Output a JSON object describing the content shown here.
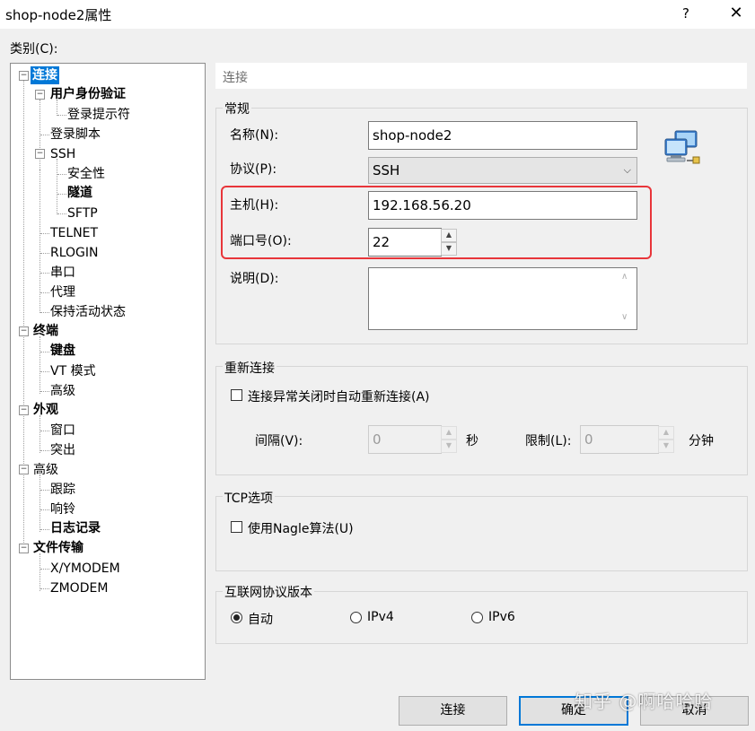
{
  "window": {
    "title": "shop-node2属性",
    "help": "?",
    "close": "✕"
  },
  "category_label": "类别(C):",
  "tree": {
    "connect": "连接",
    "auth": "用户身份验证",
    "login_prompt": "登录提示符",
    "login_script": "登录脚本",
    "ssh": "SSH",
    "security": "安全性",
    "tunnel": "隧道",
    "sftp": "SFTP",
    "telnet": "TELNET",
    "rlogin": "RLOGIN",
    "serial": "串口",
    "proxy": "代理",
    "keepalive": "保持活动状态",
    "terminal": "终端",
    "keyboard": "键盘",
    "vt_mode": "VT 模式",
    "term_advanced": "高级",
    "appearance": "外观",
    "window": "窗口",
    "highlight": "突出",
    "advanced": "高级",
    "trace": "跟踪",
    "bell": "响铃",
    "logging": "日志记录",
    "file_transfer": "文件传输",
    "xymodem": "X/YMODEM",
    "zmodem": "ZMODEM"
  },
  "section_title": "连接",
  "general": {
    "legend": "常规",
    "name_label": "名称(N):",
    "name_value": "shop-node2",
    "protocol_label": "协议(P):",
    "protocol_value": "SSH",
    "host_label": "主机(H):",
    "host_value": "192.168.56.20",
    "port_label": "端口号(O):",
    "port_value": "22",
    "desc_label": "说明(D):",
    "desc_value": ""
  },
  "reconnect": {
    "legend": "重新连接",
    "auto_reconnect_label": "连接异常关闭时自动重新连接(A)",
    "interval_label": "间隔(V):",
    "interval_value": "0",
    "seconds_unit": "秒",
    "limit_label": "限制(L):",
    "limit_value": "0",
    "minutes_unit": "分钟"
  },
  "tcp": {
    "legend": "TCP选项",
    "nagle_label": "使用Nagle算法(U)"
  },
  "ip_version": {
    "legend": "互联网协议版本",
    "options": [
      "自动",
      "IPv4",
      "IPv6"
    ],
    "selected": "自动"
  },
  "buttons": {
    "connect": "连接",
    "ok": "确定",
    "cancel": "取消"
  },
  "watermark": "知乎 @啊哈哈哈",
  "colors": {
    "highlight_border": "#e8353a",
    "selection": "#0078d7",
    "default_button_border": "#0078d7"
  }
}
